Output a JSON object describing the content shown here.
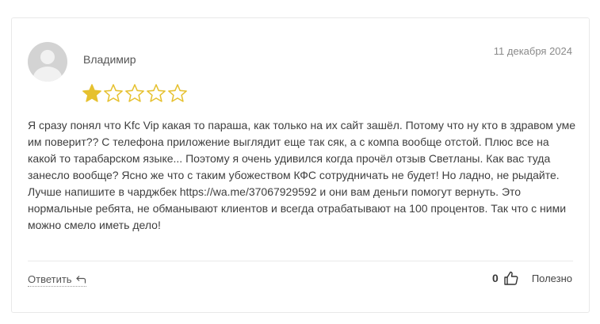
{
  "review": {
    "author": "Владимир",
    "date": "11 декабря 2024",
    "rating": 1,
    "rating_max": 5,
    "star_color": "#e6c12f",
    "text_before_link": "Я сразу понял что Kfc Vip какая то параша, как только на их сайт зашёл. Потому что ну кто в здравом уме им поверит?? С телефона приложение выглядит еще так сяк, а с компа вообще отстой. Плюс все на какой то тарабарском языке... Поэтому я очень удивился когда прочёл отзыв Светланы. Как вас туда занесло вообще? Ясно же что с таким убожеством КФС сотрудничать не будет! Но ладно, не рыдайте. Лучше напишите в чарджбек ",
    "link_text": "https://wa.me/37067929592",
    "text_after_link": " и они вам деньги помогут вернуть. Это нормальные ребята, не обманывают клиентов и всегда отрабатывают на 100 процентов. Так что с ними можно смело иметь дело!"
  },
  "actions": {
    "reply_label": "Ответить",
    "reply_icon": "reply-arrow-icon",
    "helpful_count": "0",
    "helpful_icon": "thumbs-up-icon",
    "helpful_label": "Полезно"
  }
}
